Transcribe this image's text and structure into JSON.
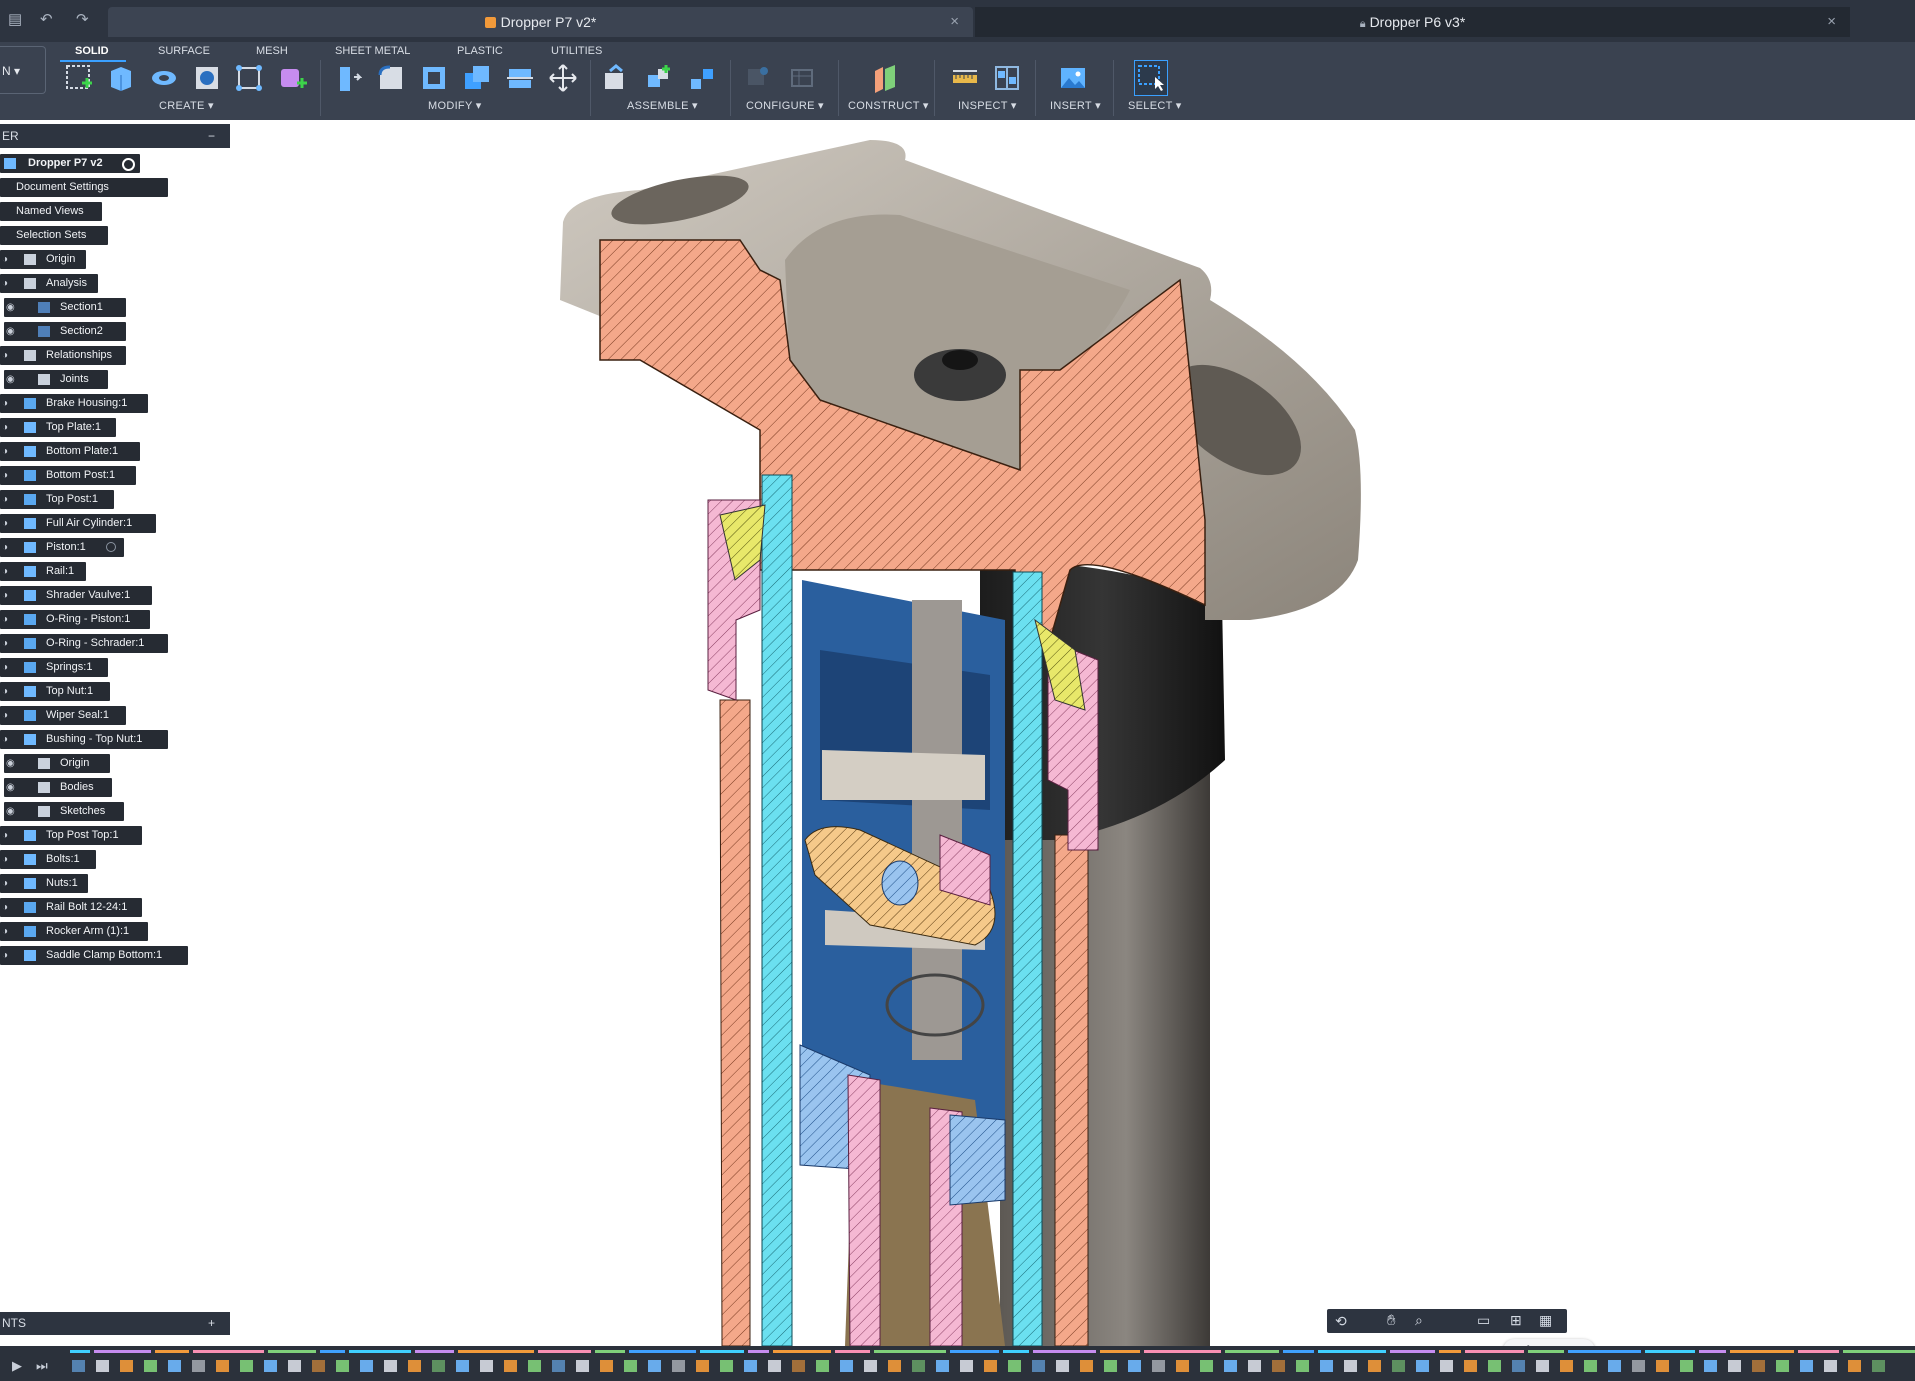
{
  "titlebar": {
    "active_tab": "Dropper P7 v2*",
    "other_tab": "Dropper P6 v3*",
    "close_symbol": "×"
  },
  "toolbar": {
    "workspace_selector": "N ▾",
    "tabs": [
      "SOLID",
      "SURFACE",
      "MESH",
      "SHEET METAL",
      "PLASTIC",
      "UTILITIES"
    ],
    "groups": [
      "CREATE ▾",
      "MODIFY ▾",
      "ASSEMBLE ▾",
      "CONFIGURE ▾",
      "CONSTRUCT ▾",
      "INSPECT ▾",
      "INSERT ▾",
      "SELECT ▾"
    ]
  },
  "browser": {
    "title": "ER",
    "collapse_symbol": "−",
    "root": "Dropper P7 v2",
    "items": [
      "Document Settings",
      "Named Views",
      "Selection Sets",
      "Origin",
      "Analysis",
      "Section1",
      "Section2",
      "Relationships",
      "Joints",
      "Brake Housing:1",
      "Top Plate:1",
      "Bottom Plate:1",
      "Bottom Post:1",
      "Top Post:1",
      "Full Air Cylinder:1",
      "Piston:1",
      "Rail:1",
      "Shrader Vaulve:1",
      "O-Ring - Piston:1",
      "O-Ring - Schrader:1",
      "Springs:1",
      "Top Nut:1",
      "Wiper Seal:1",
      "Bushing - Top Nut:1",
      "Origin",
      "Bodies",
      "Sketches",
      "Top Post Top:1",
      "Bolts:1",
      "Nuts:1",
      "Rail Bolt 12-24:1",
      "Rocker Arm (1):1",
      "Saddle Clamp Bottom:1"
    ]
  },
  "comments": {
    "title": "NTS",
    "add_symbol": "+"
  },
  "viewports_tooltip": "Viewports",
  "colors": {
    "titlebar_bg": "#2d3440",
    "toolbar_bg": "#3a4250",
    "tree_item_bg": "#262b33",
    "accent": "#3aa0ff",
    "hatch_orange": "#f4a88a",
    "hatch_cyan": "#6be0f0",
    "hatch_pink": "#f5b8d3",
    "hatch_yellow": "#e8e86a",
    "part_blue": "#2a5f9e",
    "part_gray": "#b5ac9f"
  },
  "icons": {
    "titlebar": [
      "file-icon",
      "undo-icon",
      "redo-icon",
      "lock-icon"
    ],
    "tree": [
      "eye-icon",
      "folder-icon",
      "component-icon",
      "body-icon",
      "radio-icon"
    ],
    "nav": [
      "orbit-icon",
      "pan-icon",
      "zoom-icon",
      "display-icon",
      "grid-icon",
      "viewports-icon"
    ],
    "timeline": [
      "play-icon",
      "step-forward-icon"
    ]
  }
}
